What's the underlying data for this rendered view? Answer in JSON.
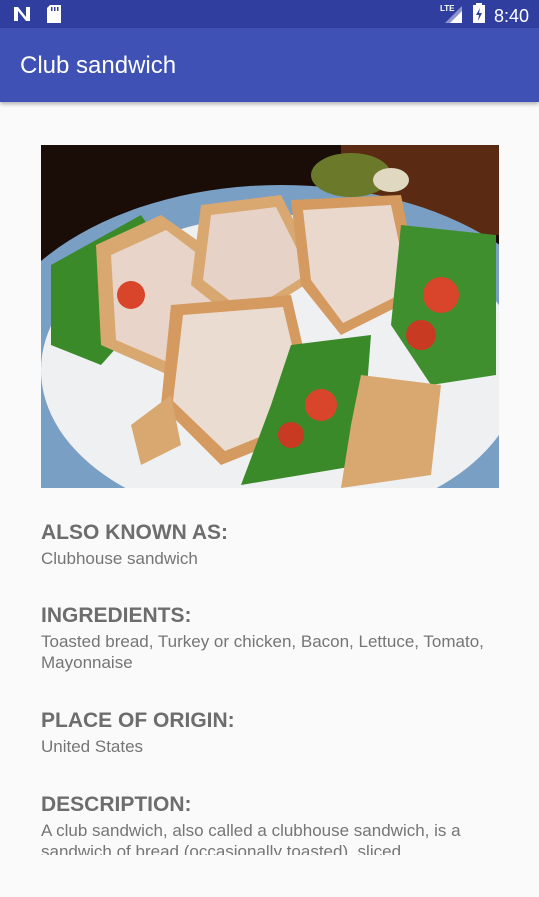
{
  "status_bar": {
    "time": "8:40",
    "network": "LTE",
    "icons": [
      "notification-n-icon",
      "sd-card-icon",
      "signal-icon",
      "battery-charging-icon"
    ]
  },
  "app_bar": {
    "title": "Club sandwich"
  },
  "image": {
    "subject": "club-sandwich-photo"
  },
  "sections": {
    "aka": {
      "title": "ALSO KNOWN AS:",
      "value": "Clubhouse sandwich"
    },
    "ingredients": {
      "title": "INGREDIENTS:",
      "value": "Toasted bread, Turkey or chicken, Bacon, Lettuce, Tomato, Mayonnaise"
    },
    "origin": {
      "title": "PLACE OF ORIGIN:",
      "value": "United States"
    },
    "description": {
      "title": "DESCRIPTION:",
      "value": "A club sandwich, also called a clubhouse sandwich, is a sandwich of bread (occasionally toasted), sliced"
    }
  },
  "colors": {
    "primary": "#3f51b5",
    "primary_dark": "#303f9f",
    "background": "#fafafa",
    "title_text": "#6d6d6d",
    "body_text": "#757575"
  }
}
